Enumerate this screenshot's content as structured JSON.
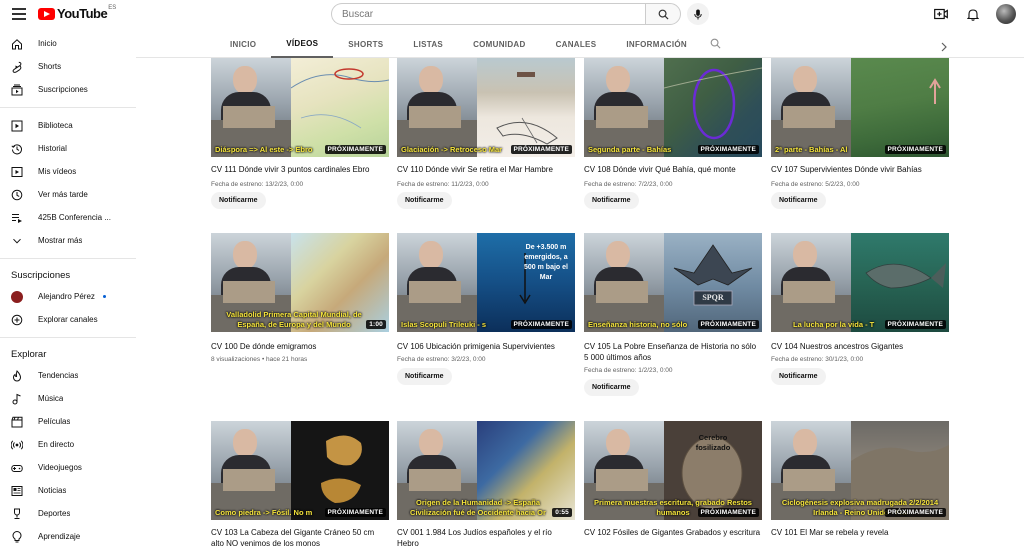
{
  "header": {
    "logo_text": "YouTube",
    "country": "ES",
    "search_placeholder": "Buscar"
  },
  "sidebar": {
    "main": [
      "Inicio",
      "Shorts",
      "Suscripciones"
    ],
    "library": [
      "Biblioteca",
      "Historial",
      "Mis vídeos",
      "Ver más tarde",
      "425B Conferencia ...",
      "Mostrar más"
    ],
    "subs_heading": "Suscripciones",
    "subs": [
      "Alejandro Pérez",
      "Explorar canales"
    ],
    "explore_heading": "Explorar",
    "explore": [
      "Tendencias",
      "Música",
      "Películas",
      "En directo",
      "Videojuegos",
      "Noticias",
      "Deportes",
      "Aprendizaje"
    ]
  },
  "tabs": [
    "INICIO",
    "VÍDEOS",
    "SHORTS",
    "LISTAS",
    "COMUNIDAD",
    "CANALES",
    "INFORMACIÓN"
  ],
  "notify_label": "Notificarme",
  "videos": [
    {
      "title": "CV 111 Dónde vivir 3 puntos cardinales Ebro",
      "caption": "Diáspora => Al este -> Ebro",
      "badge": "PRÓXIMAMENTE",
      "meta": "Fecha de estreno: 13/2/23, 0:00"
    },
    {
      "title": "CV 110 Dónde vivir Se retira el Mar Hambre",
      "caption": "Glaciación -> Retroceso Mar",
      "badge": "PRÓXIMAMENTE",
      "meta": "Fecha de estreno: 11/2/23, 0:00"
    },
    {
      "title": "CV 108 Dónde vivir Qué Bahía, qué monte",
      "caption": "Segunda parte - Bahías",
      "badge": "PRÓXIMAMENTE",
      "meta": "Fecha de estreno: 7/2/23, 0:00"
    },
    {
      "title": "CV 107 Supervivientes Dónde vivir Bahías",
      "caption": "2ª parte - Bahías - Al",
      "badge": "PRÓXIMAMENTE",
      "meta": "Fecha de estreno: 5/2/23, 0:00"
    },
    {
      "title": "CV 100 De dónde emigramos",
      "caption": "Valladolid Primera Capital Mundial, de España, de Europa y del Mundo",
      "badge": "1:00",
      "meta": "8 visualizaciones • hace 21 horas"
    },
    {
      "title": "CV 106 Ubicación primigenia Supervivientes",
      "caption": "Islas Scopuli Trileuki - s",
      "badge": "PRÓXIMAMENTE",
      "meta": "Fecha de estreno: 3/2/23, 0:00",
      "overlay": "De +3.500 m emergidos, a 500 m bajo el Mar"
    },
    {
      "title": "CV 105 La Pobre Enseñanza de Historia no sólo 5 000 últimos años",
      "caption": "Enseñanza historia, no sólo",
      "badge": "PRÓXIMAMENTE",
      "meta": "Fecha de estreno: 1/2/23, 0:00",
      "overlay": "SPQR"
    },
    {
      "title": "CV 104 Nuestros ancestros Gigantes",
      "caption": "La lucha por la vida - T",
      "badge": "PRÓXIMAMENTE",
      "meta": "Fecha de estreno: 30/1/23, 0:00"
    },
    {
      "title": "CV 103 La Cabeza del Gigante Cráneo 50 cm alto NO venimos de los monos",
      "caption": "Como piedra -> Fósil. No m",
      "badge": "PRÓXIMAMENTE",
      "meta": ""
    },
    {
      "title": "CV 001 1.984 Los Judíos españoles y el río Hebro",
      "caption": "Origen de la Humanidad -> España Civilización fué de Occidente hacia Or",
      "badge": "0:55",
      "meta": ""
    },
    {
      "title": "CV 102 Fósiles de Gigantes Grabados y escritura",
      "caption": "Primera muestras escritura, grabado Restos humanos",
      "badge": "PRÓXIMAMENTE",
      "meta": "",
      "overlay": "Cerebro fosilizado"
    },
    {
      "title": "CV 101 El Mar se rebela y revela",
      "caption": "Ciclogénesis explosiva madrugada 2/2/2014 Irlanda - Reino Unido - Fra",
      "badge": "PRÓXIMAMENTE",
      "meta": ""
    }
  ]
}
